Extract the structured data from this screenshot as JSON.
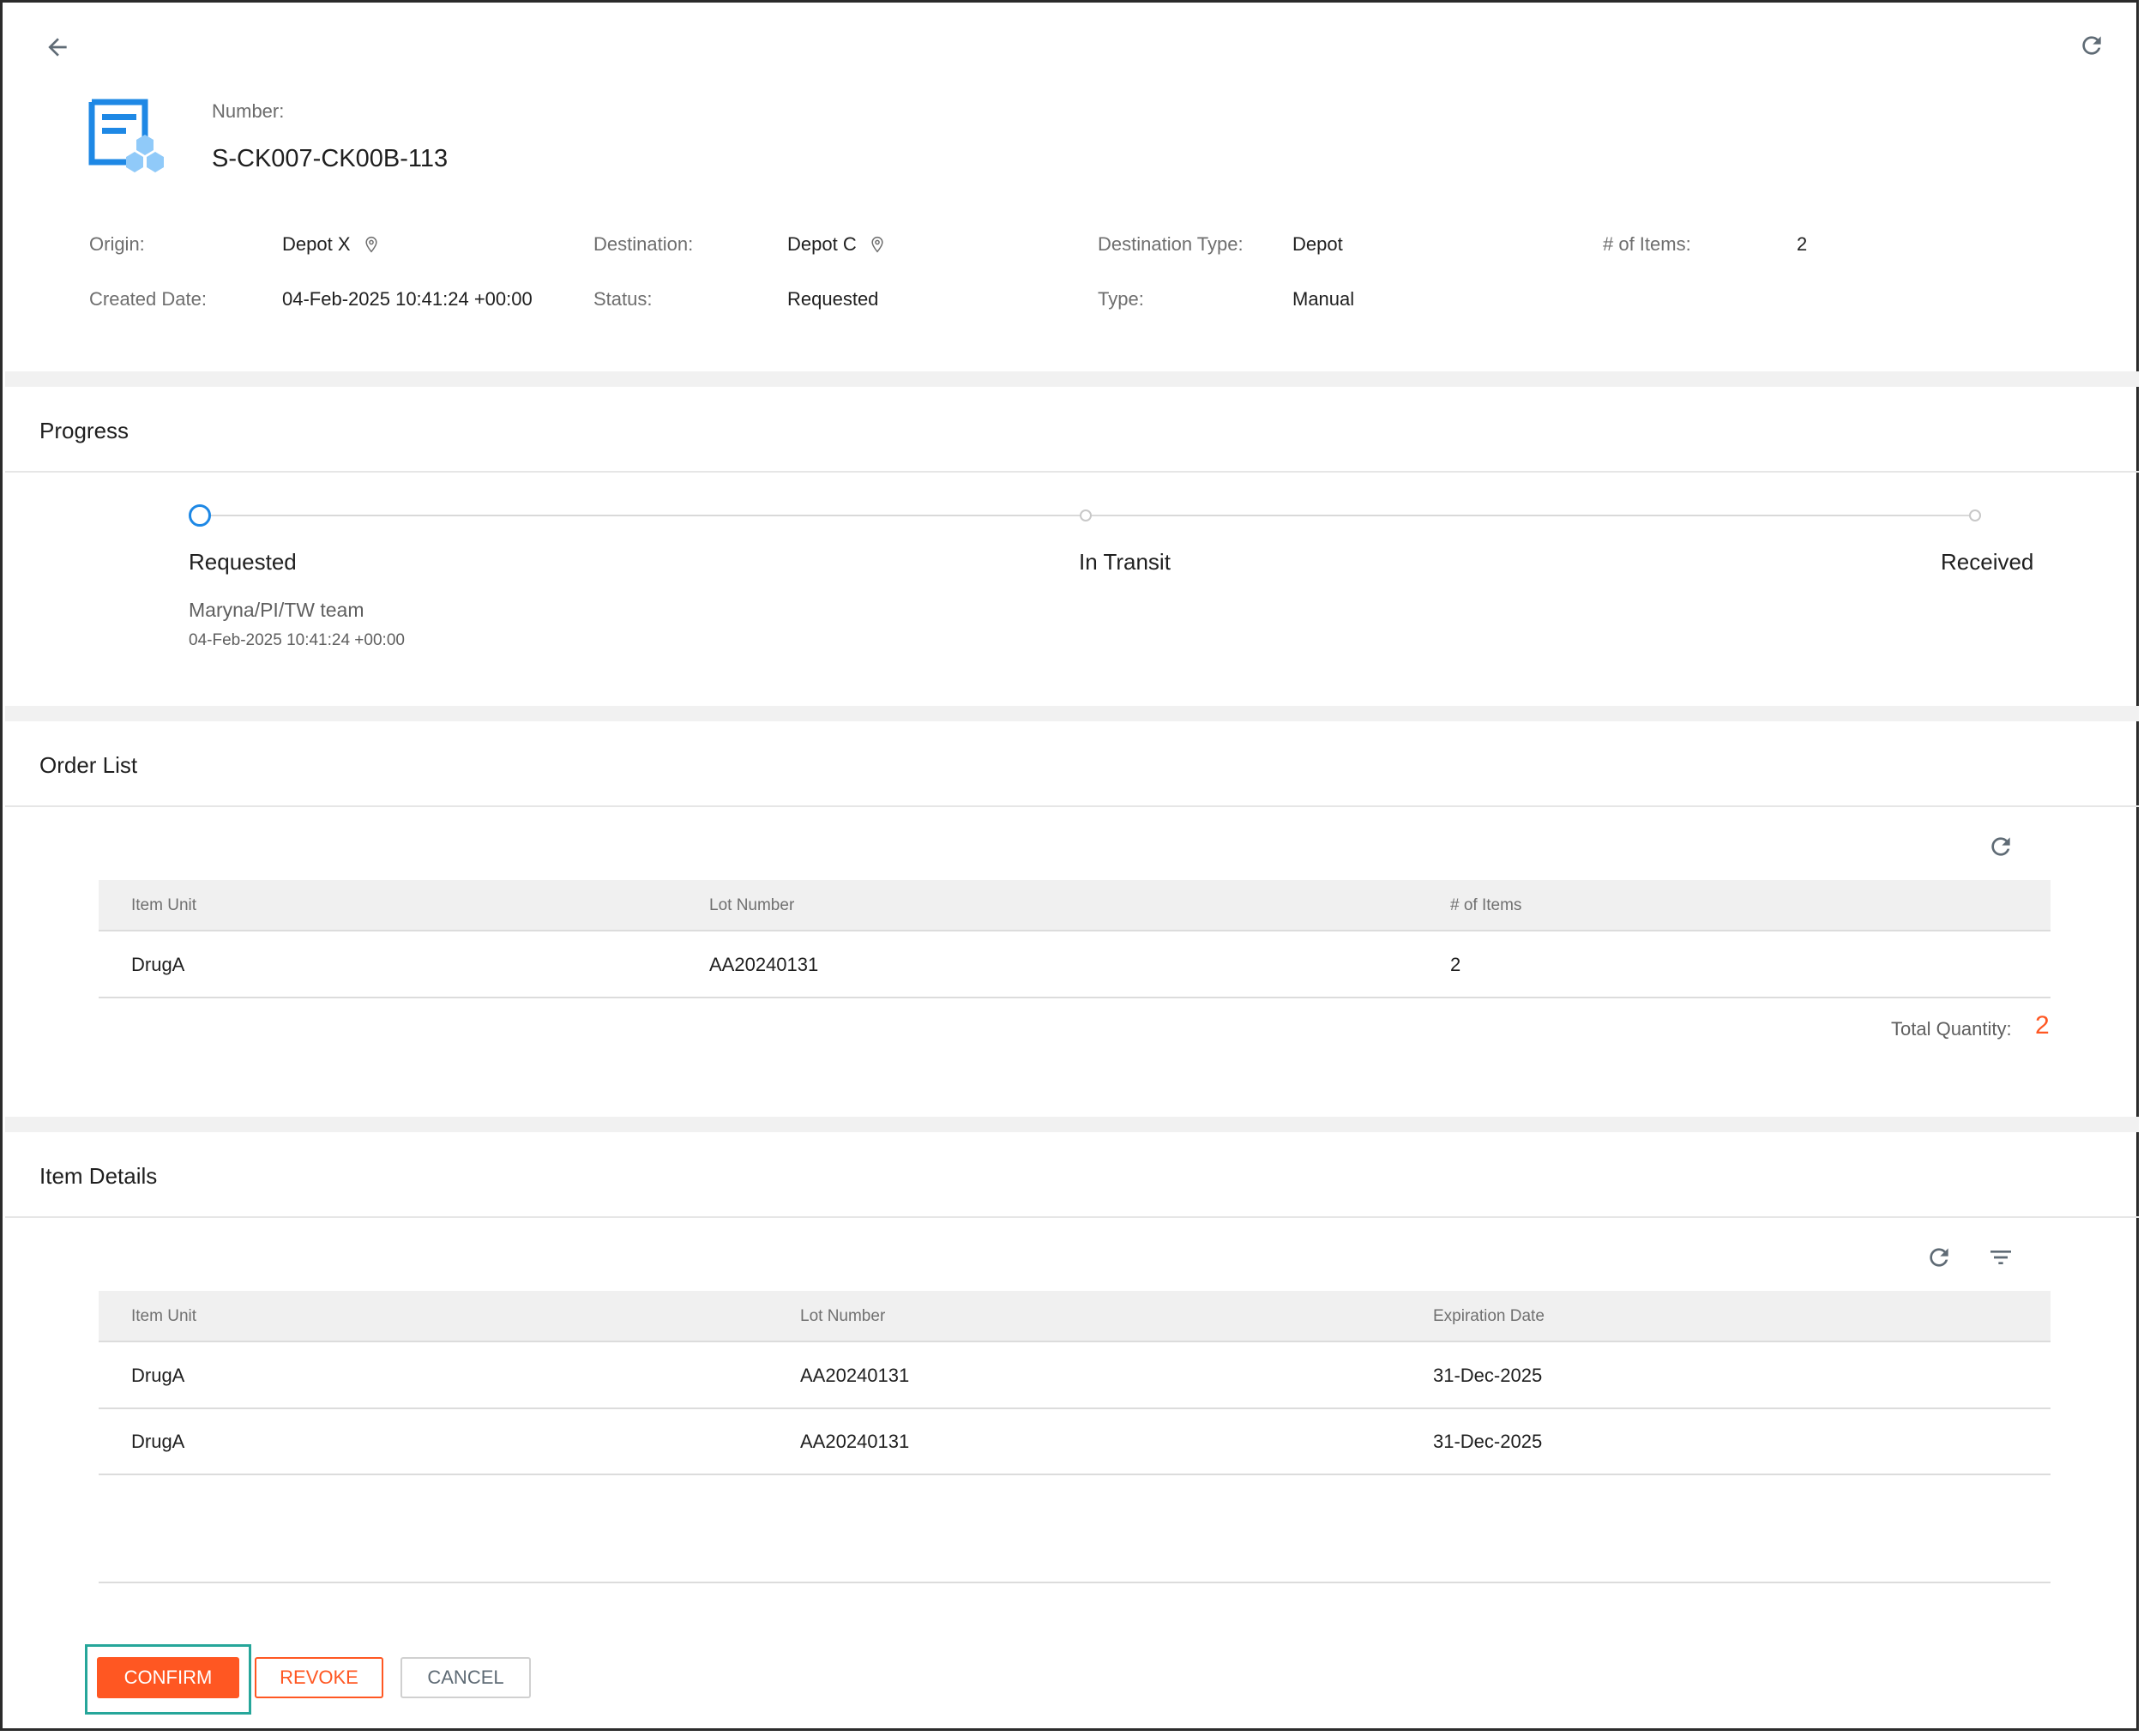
{
  "header": {
    "number_label": "Number:",
    "number_value": "S-CK007-CK00B-113",
    "back_icon": "arrow-left-icon",
    "refresh_icon": "refresh-icon"
  },
  "details": {
    "origin_label": "Origin:",
    "origin_value": "Depot X",
    "destination_label": "Destination:",
    "destination_value": "Depot C",
    "destination_type_label": "Destination Type:",
    "destination_type_value": "Depot",
    "items_label": "# of Items:",
    "items_value": "2",
    "created_label": "Created Date:",
    "created_value": "04-Feb-2025 10:41:24 +00:00",
    "status_label": "Status:",
    "status_value": "Requested",
    "type_label": "Type:",
    "type_value": "Manual"
  },
  "progress": {
    "title": "Progress",
    "steps": [
      {
        "label": "Requested",
        "active": true
      },
      {
        "label": "In Transit",
        "active": false
      },
      {
        "label": "Received",
        "active": false
      }
    ],
    "requested_by": "Maryna/PI/TW team",
    "requested_at": "04-Feb-2025 10:41:24 +00:00"
  },
  "order_list": {
    "title": "Order List",
    "columns": [
      "Item Unit",
      "Lot Number",
      "# of Items"
    ],
    "rows": [
      [
        "DrugA",
        "AA20240131",
        "2"
      ]
    ],
    "total_label": "Total Quantity:",
    "total_value": "2"
  },
  "item_details": {
    "title": "Item Details",
    "columns": [
      "Item Unit",
      "Lot Number",
      "Expiration Date"
    ],
    "rows": [
      [
        "DrugA",
        "AA20240131",
        "31-Dec-2025"
      ],
      [
        "DrugA",
        "AA20240131",
        "31-Dec-2025"
      ]
    ]
  },
  "actions": {
    "confirm": "CONFIRM",
    "revoke": "REVOKE",
    "cancel": "CANCEL"
  },
  "colors": {
    "accent_orange": "#ff5722",
    "active_blue": "#1e88e5",
    "highlight_teal": "#26a69a"
  }
}
